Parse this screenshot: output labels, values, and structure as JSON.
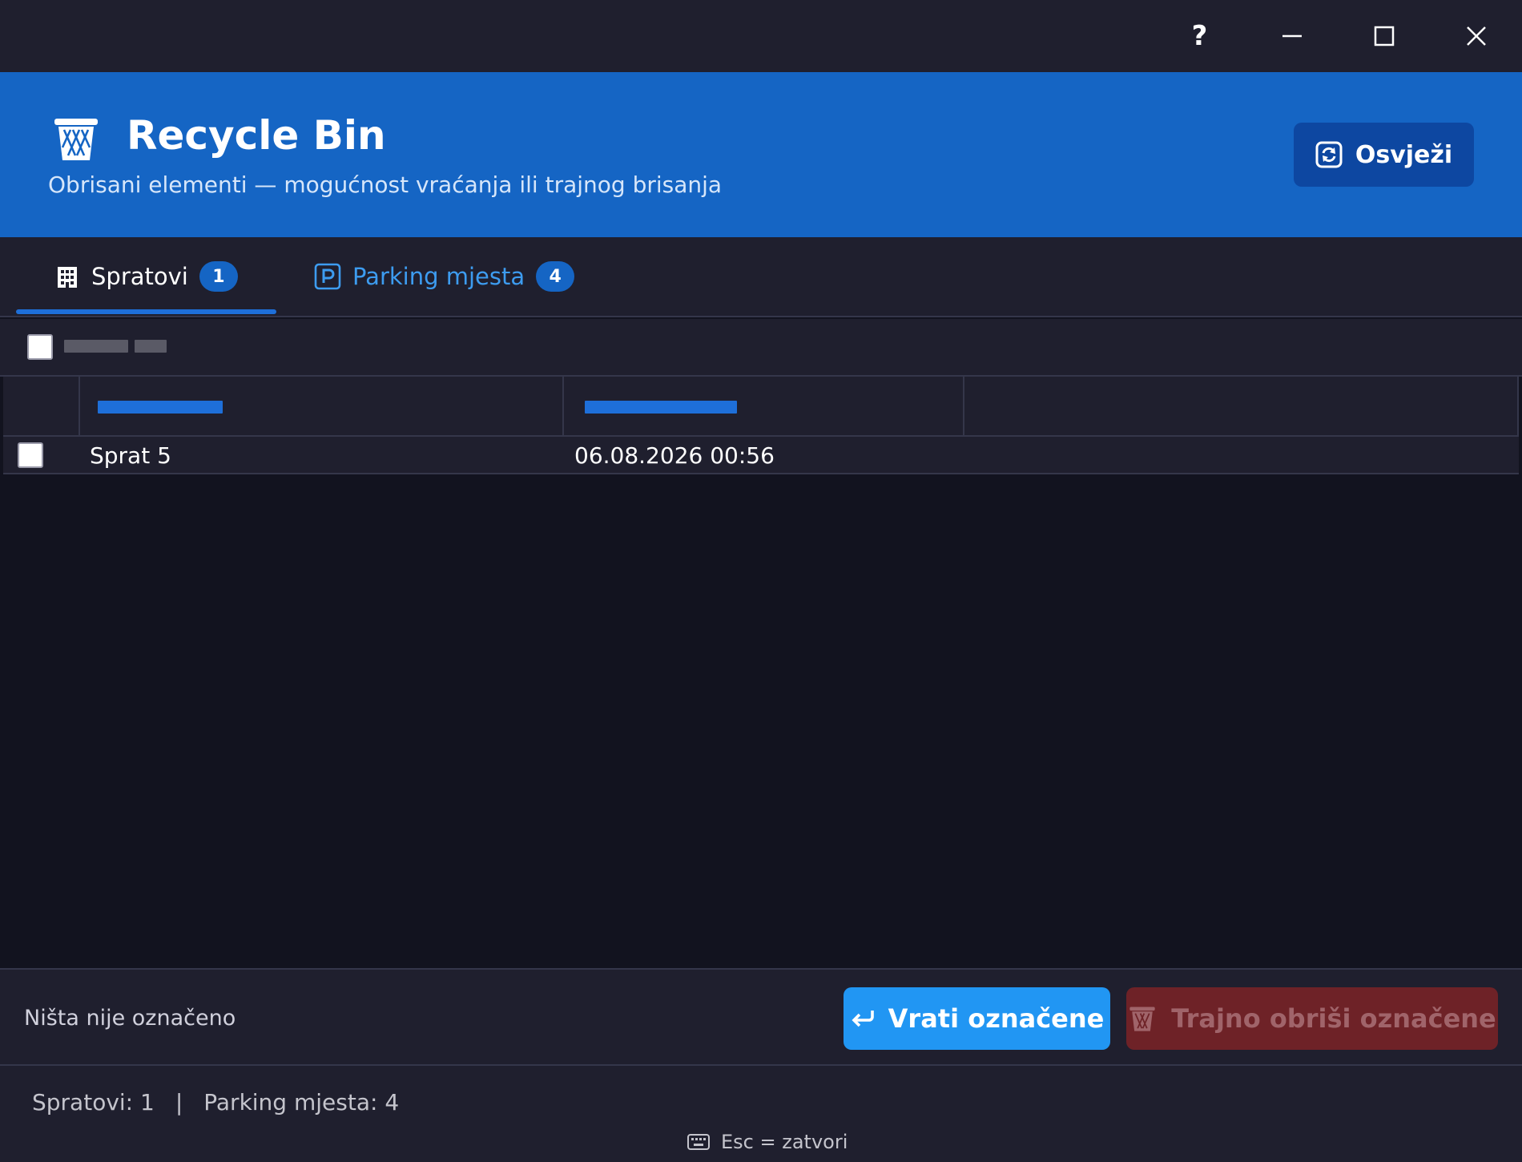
{
  "titlebar": {
    "help_label": "?"
  },
  "header": {
    "title": "Recycle Bin",
    "subtitle": "Obrisani elementi — mogućnost vraćanja ili trajnog brisanja",
    "refresh_label": "Osvježi",
    "background_color": "#1565c4",
    "refresh_button_color": "#0d47a1"
  },
  "tabs": [
    {
      "label": "Spratovi",
      "badge": "1",
      "icon": "building-icon",
      "active": true
    },
    {
      "label": "Parking mjesta",
      "badge": "4",
      "icon": "parking-icon",
      "active": false
    }
  ],
  "table": {
    "rows": [
      {
        "name": "Sprat 5",
        "deleted_at": "06.08.2026 00:56",
        "checked": false
      }
    ]
  },
  "actions": {
    "selection_status": "Ništa nije označeno",
    "restore_label": "Vrati označene",
    "delete_label": "Trajno obriši označene",
    "restore_color": "#2196f3",
    "delete_color": "#6e2227"
  },
  "footer": {
    "floors_count": "Spratovi: 1",
    "separator": "|",
    "parking_count": "Parking mjesta: 4",
    "hint": "Esc = zatvori",
    "hint_icon": "keyboard-icon"
  }
}
